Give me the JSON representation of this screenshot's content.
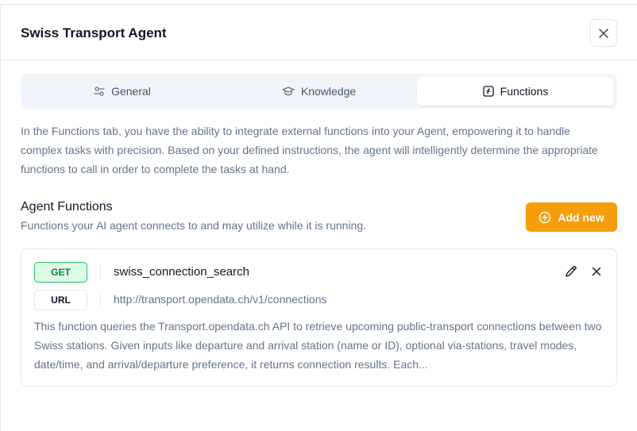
{
  "dialog": {
    "title": "Swiss Transport Agent"
  },
  "tabs": [
    {
      "label": "General",
      "icon": "sliders-icon"
    },
    {
      "label": "Knowledge",
      "icon": "graduation-cap-icon"
    },
    {
      "label": "Functions",
      "icon": "function-icon",
      "active": true
    }
  ],
  "intro": "In the Functions tab, you have the ability to integrate external functions into your Agent, empowering it to handle complex tasks with precision. Based on your defined instructions, the agent will intelligently determine the appropriate functions to call in order to complete the tasks at hand.",
  "section": {
    "title": "Agent Functions",
    "subtitle": "Functions your AI agent connects to and may utilize while it is running.",
    "add_label": "Add new"
  },
  "function_card": {
    "method": "GET",
    "url_label": "URL",
    "name": "swiss_connection_search",
    "url": "http://transport.opendata.ch/v1/connections",
    "description": "This function queries the Transport.opendata.ch API to retrieve upcoming public-transport connections between two Swiss stations. Given inputs like departure and arrival station (name or ID), optional via-stations, travel modes, date/time, and arrival/departure preference, it returns connection results. Each..."
  },
  "colors": {
    "accent": "#f59e0b",
    "get_badge_bg": "#dcfce7",
    "get_badge_border": "#22c55e",
    "muted_text": "#64748b"
  }
}
